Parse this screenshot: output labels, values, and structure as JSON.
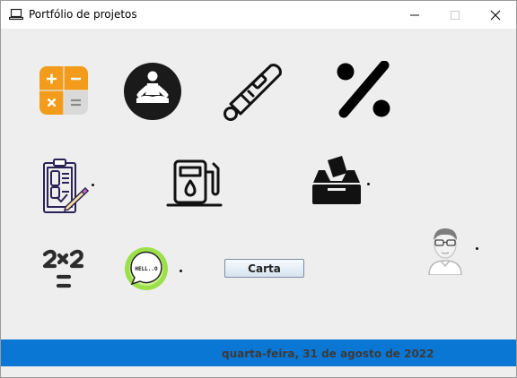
{
  "window": {
    "title": "Portfólio de projetos"
  },
  "icons": [
    {
      "name": "calculator-icon",
      "project": "calculadora"
    },
    {
      "name": "meditation-icon",
      "project": "meditacao"
    },
    {
      "name": "thermometer-icon",
      "project": "termometro"
    },
    {
      "name": "percent-icon",
      "project": "porcentagem"
    },
    {
      "name": "clipboard-checklist-icon",
      "project": "lista"
    },
    {
      "name": "fuel-pump-icon",
      "project": "combustivel"
    },
    {
      "name": "ballot-box-icon",
      "project": "votacao"
    },
    {
      "name": "avatar-glasses-icon",
      "project": "perfil"
    },
    {
      "name": "times-table-icon",
      "project": "tabuada"
    },
    {
      "name": "hello-bubble-icon",
      "project": "ola"
    }
  ],
  "hello_bubble_text": "HELL..O",
  "dot_char": ".",
  "carta_button_label": "Carta",
  "status_date": "quarta-feira, 31 de agosto de 2022",
  "colors": {
    "status_bar": "#0a77d4",
    "calc_orange": "#f39b1a",
    "calc_gray": "#d9d9d9",
    "hello_green": "#9be04a",
    "clipboard_purple": "#2a2357"
  }
}
